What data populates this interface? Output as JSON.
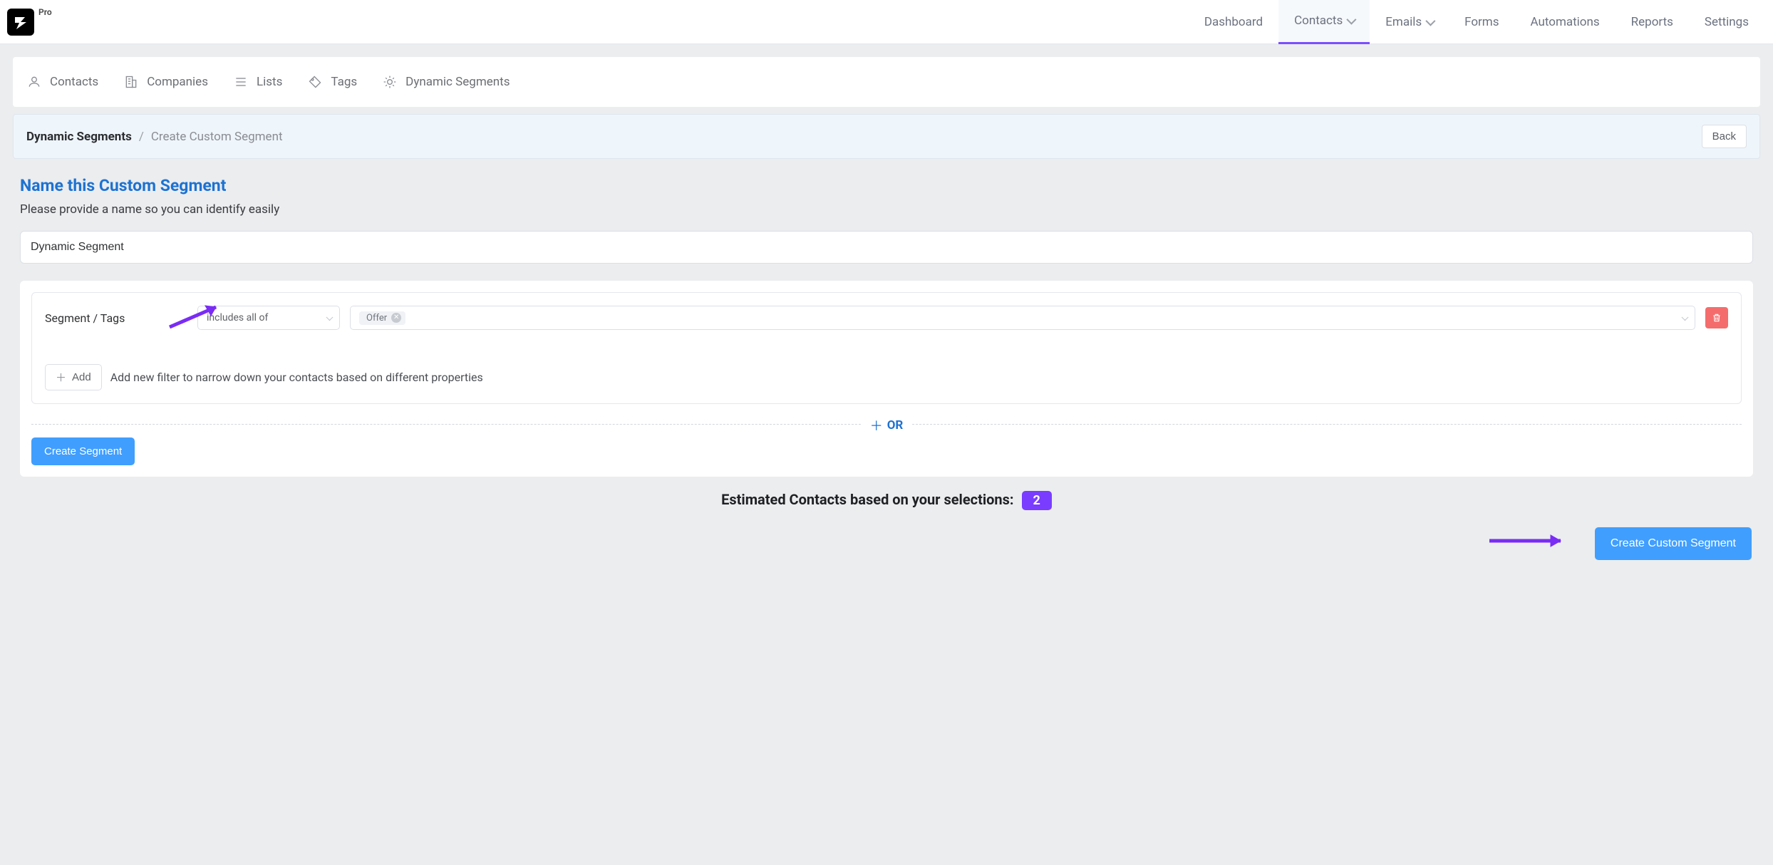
{
  "brand": {
    "pro_label": "Pro"
  },
  "nav": {
    "dashboard": "Dashboard",
    "contacts": "Contacts",
    "emails": "Emails",
    "forms": "Forms",
    "automations": "Automations",
    "reports": "Reports",
    "settings": "Settings"
  },
  "subtabs": {
    "contacts": "Contacts",
    "companies": "Companies",
    "lists": "Lists",
    "tags": "Tags",
    "dynamic_segments": "Dynamic Segments"
  },
  "breadcrumb": {
    "root": "Dynamic Segments",
    "sep": "/",
    "tail": "Create Custom Segment",
    "back": "Back"
  },
  "section": {
    "title": "Name this Custom Segment",
    "subtitle": "Please provide a name so you can identify easily",
    "name_value": "Dynamic Segment"
  },
  "filter": {
    "field_label": "Segment / Tags",
    "operator": "includes all of",
    "tag_chip": "Offer",
    "add_button": "Add",
    "add_hint": "Add new filter to narrow down your contacts based on different properties",
    "or_label": "OR",
    "create_segment": "Create Segment"
  },
  "estimate": {
    "text": "Estimated Contacts based on your selections:",
    "count": "2"
  },
  "footer": {
    "create_custom": "Create Custom Segment"
  }
}
